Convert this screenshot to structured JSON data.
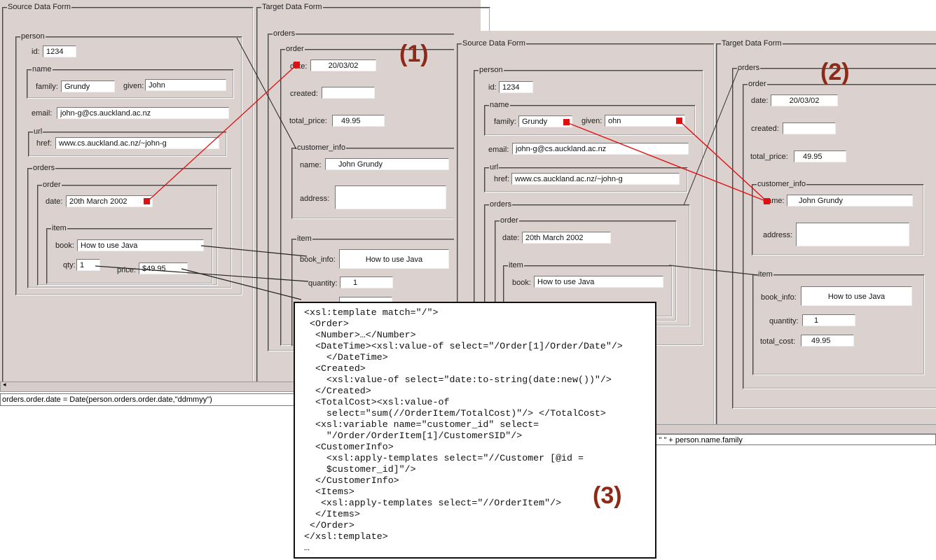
{
  "colors": {
    "panel_bg": "#dbd1cf",
    "mapping_line": "#e01010",
    "connector_line": "#222222",
    "marker": "#8c2a17"
  },
  "markers": [
    "(1)",
    "(2)",
    "(3)"
  ],
  "screen1": {
    "source_title": "Source Data Form",
    "target_title": "Target Data Form",
    "source": {
      "person": "person",
      "id_label": "id:",
      "id": "1234",
      "name": "name",
      "family_label": "family:",
      "family": "Grundy",
      "given_label": "given:",
      "given": "John",
      "email_label": "email:",
      "email": "john-g@cs.auckland.ac.nz",
      "url": "url",
      "href_label": "href:",
      "href": "www.cs.auckland.ac.nz/~john-g",
      "orders": "orders",
      "order": "order",
      "date_label": "date:",
      "date": "20th March 2002",
      "item": "item",
      "book_label": "book:",
      "book": "How to use Java",
      "qty_label": "qty:",
      "qty": "1",
      "price_label": "price:",
      "price": "$49.95"
    },
    "target": {
      "orders": "orders",
      "order": "order",
      "date_label": "date:",
      "date": "20/03/02",
      "created_label": "created:",
      "created": "",
      "total_price_label": "total_price:",
      "total_price": "49.95",
      "customer_info": "customer_info",
      "name_label": "name:",
      "name": "John Grundy",
      "address_label": "address:",
      "address": "",
      "item": "item",
      "book_info_label": "book_info:",
      "book_info": "How to use Java",
      "quantity_label": "quantity:",
      "quantity": "1"
    },
    "status": "orders.order.date = Date(person.orders.order.date,\"ddmmyy\")"
  },
  "screen2": {
    "source_title": "Source Data Form",
    "target_title": "Target Data Form",
    "source": {
      "person": "person",
      "id_label": "id:",
      "id": "1234",
      "name": "name",
      "family_label": "family:",
      "family": "Grundy",
      "given_label": "given:",
      "given": "ohn",
      "email_label": "email:",
      "email": "john-g@cs.auckland.ac.nz",
      "url": "url",
      "href_label": "href:",
      "href": "www.cs.auckland.ac.nz/~john-g",
      "orders": "orders",
      "order": "order",
      "date_label": "date:",
      "date": "20th March 2002",
      "item": "item",
      "book_label": "book:",
      "book": "How to use Java"
    },
    "target": {
      "orders": "orders",
      "order": "order",
      "date_label": "date:",
      "date": "20/03/02",
      "created_label": "created:",
      "created": "",
      "total_price_label": "total_price:",
      "total_price": "49.95",
      "customer_info": "customer_info",
      "name_label": "name:",
      "name": "John Grundy",
      "address_label": "address:",
      "address": "",
      "item": "item",
      "book_info_label": "book_info:",
      "book_info": "How to use Java",
      "quantity_label": "quantity:",
      "quantity": "1",
      "total_cost_label": "total_cost:",
      "total_cost": "49.95"
    },
    "status": "+ \" \" + person.name.family"
  },
  "code": {
    "lines": [
      "<xsl:template match=\"/\">",
      " <Order>",
      "  <Number>…</Number>",
      "  <DateTime><xsl:value-of select=\"/Order[1]/Order/Date\"/>",
      "    </DateTime>",
      "  <Created>",
      "    <xsl:value-of select=\"date:to-string(date:new())\"/>",
      "  </Created>",
      "  <TotalCost><xsl:value-of",
      "    select=\"sum(//OrderItem/TotalCost)\"/> </TotalCost>",
      "  <xsl:variable name=\"customer_id\" select=",
      "    \"/Order/OrderItem[1]/CustomerSID\"/>",
      "  <CustomerInfo>",
      "    <xsl:apply-templates select=\"//Customer [@id =",
      "    $customer_id]\"/>",
      "  </CustomerInfo>",
      "  <Items>",
      "   <xsl:apply-templates select=\"//OrderItem\"/>",
      "  </Items>",
      " </Order>",
      "</xsl:template>",
      "…"
    ]
  }
}
